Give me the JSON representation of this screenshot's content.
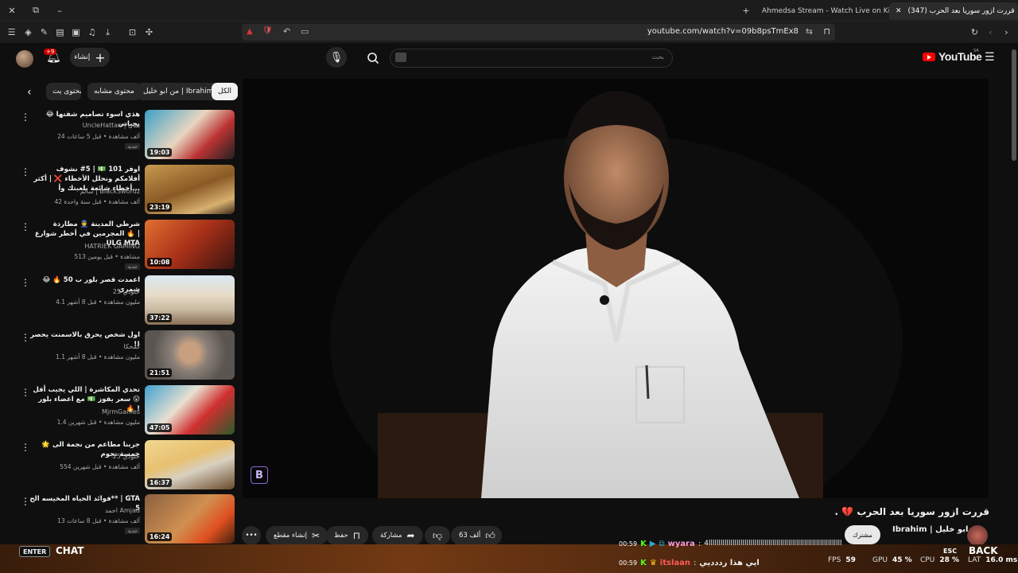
{
  "browser": {
    "tabs": [
      {
        "label": "Ahmedsa Stream - Watch Live on Kick"
      },
      {
        "label": "(347) قررت ازور سوريا بعد الحرب"
      }
    ],
    "url": "youtube.com/watch?v=09b8psTmEx8"
  },
  "youtube": {
    "logo": "YouTube",
    "region": "SA",
    "search_placeholder": "بحث",
    "create_label": "إنشاء",
    "notif_count": "+9"
  },
  "chips": {
    "all": "الكل",
    "from_channel": "من ابو خليل | Ibrahim",
    "similar": "محتوى مشابه",
    "more": "محتوى يت"
  },
  "videos": [
    {
      "title": "😂 هذي اسوء تصاميم شفتها بحياتي",
      "channel": "UncleHattan | هتان",
      "meta": "24 ألف مشاهدة • قبل 5 ساعات",
      "badge": "جديد",
      "duration": "19:03"
    },
    {
      "title": "اوفر 101 💵 | 5# نشوف أفلامكم ونحلل الأخطاء ❌ | أكثر أخطاء شائعة بلعبتك وأ...",
      "channel": "سالم | BlackSwordz",
      "meta": "42 ألف مشاهدة • قبل سنة واحدة",
      "badge": "",
      "duration": "23:19"
    },
    {
      "title": "شرطي المدينة 👮 مطاردة المجرمين في أخطر شوارع 🔥 | ULG MTA",
      "channel": "HATRIEK GAMING",
      "meta": "513 مشاهدة • قبل يومين",
      "badge": "جديد",
      "duration": "10:08"
    },
    {
      "title": "😂 🔥 اعمدت قصر بلور ب 50 شمري",
      "channel": "خلودي 25",
      "meta": "4.1 مليون مشاهدة • قبل 8 أشهر",
      "badge": "",
      "duration": "37:22"
    },
    {
      "title": "اول شخص يحرق بالاسمنت يحصر !!",
      "channel": "كمحكا",
      "meta": "1.1 مليون مشاهدة • قبل 8 أشهر",
      "badge": "",
      "duration": "21:51"
    },
    {
      "title": "تحدي المكاشرة | اللي يجيب أقل سعر يفوز 💵 مع اعضاء بلور 😮 🔥 !",
      "channel": "MjrmGames",
      "meta": "1.4 مليون مشاهدة • قبل شهرين",
      "badge": "",
      "duration": "47:05"
    },
    {
      "title": "🌟 جربنا مطاعم من نجمة الى خمسة نجوم",
      "channel": "خلودي 25",
      "meta": "554 ألف مشاهدة • قبل شهرين",
      "badge": "",
      "duration": "16:37"
    },
    {
      "title": "فوائد الحياه المخيسه الح** | GTA 5",
      "channel": "احمد Amjad",
      "meta": "13 ألف مشاهدة • قبل 8 ساعات",
      "badge": "جديد",
      "duration": "16:24"
    }
  ],
  "player": {
    "title": "قررت ازور سوريا بعد الحرب 💔 .",
    "channel": "ابو خليل | Ibrahim",
    "subscribe": "مشترك",
    "likes": "63 ألف",
    "share": "مشاركة",
    "save": "حفظ",
    "clip": "إنشاء مقطع",
    "watermark": "B"
  },
  "overlay": {
    "enter": "ENTER",
    "chat": "CHAT",
    "esc": "ESC",
    "back": "BACK",
    "messages": [
      {
        "time": "00:59",
        "user": "wyara",
        "text": "4ااااااااااااااااااااااااااااااااااااااااااااااااااااااااااااااااااا",
        "user_color": "#ff9ad5"
      },
      {
        "time": "00:59",
        "user": "itslaan",
        "text": "ايي هذا رددديي",
        "user_color": "#ff5a5a"
      }
    ],
    "stats": {
      "fps": "59",
      "gpu": "45 %",
      "cpu": "28 %",
      "lat": "16.0 ms",
      "fps_label": "FPS",
      "gpu_label": "GPU",
      "cpu_label": "CPU",
      "lat_label": "LAT"
    }
  }
}
